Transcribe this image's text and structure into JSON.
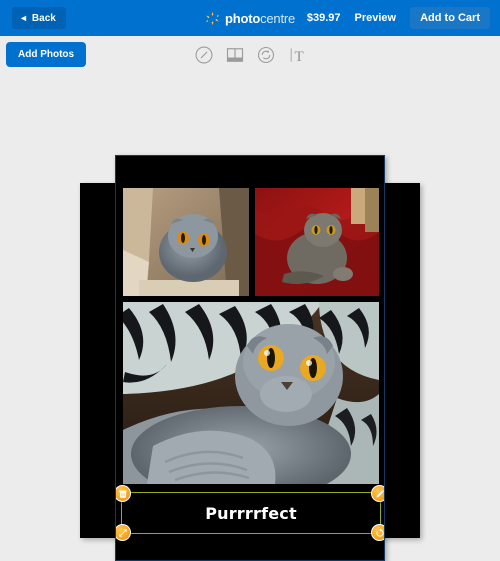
{
  "header": {
    "back_label": "Back",
    "back_icon": "left-arrow-icon",
    "brand_bold": "photo",
    "brand_light": "centre",
    "brand_icon": "walmart-spark-icon",
    "price": "$39.97",
    "preview_label": "Preview",
    "cart_label": "Add to Cart",
    "accent_color": "#0071ce"
  },
  "toolbar": {
    "add_photos_label": "Add Photos",
    "tools": [
      {
        "name": "effects-icon",
        "title": "Effects"
      },
      {
        "name": "layout-icon",
        "title": "Layout"
      },
      {
        "name": "rotate-icon",
        "title": "Rotate"
      },
      {
        "name": "text-icon",
        "title": "Add Text"
      }
    ]
  },
  "canvas": {
    "photos": [
      {
        "name": "photo-cat-in-box",
        "alt": "Grey Scottish Fold cat sitting inside a cardboard box"
      },
      {
        "name": "photo-cat-on-red-couch",
        "alt": "Grey cat sitting on a red blanket"
      },
      {
        "name": "photo-cat-on-blanket",
        "alt": "Grey Scottish Fold cat lying on a zebra print blanket"
      }
    ],
    "text_object": {
      "caption": "Purrrrfect",
      "selection_color": "#9aa824",
      "handle_color": "#f5a623",
      "handles": [
        {
          "name": "delete-handle",
          "icon": "trash-icon",
          "position": "top-left"
        },
        {
          "name": "edit-handle",
          "icon": "pencil-icon",
          "position": "top-right"
        },
        {
          "name": "resize-handle",
          "icon": "resize-icon",
          "position": "bottom-left"
        },
        {
          "name": "rotate-handle",
          "icon": "rotate-icon",
          "position": "bottom-right"
        }
      ]
    }
  }
}
